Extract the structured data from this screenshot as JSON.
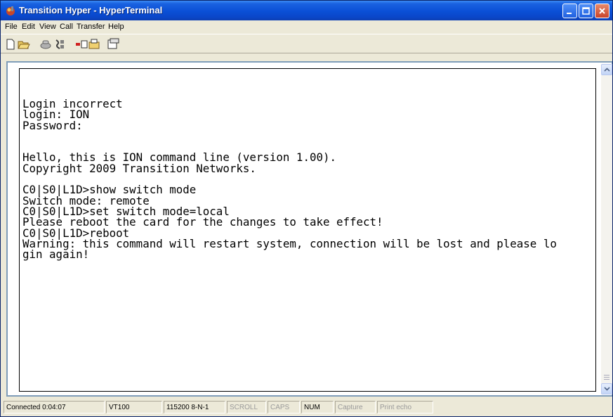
{
  "window": {
    "title": "Transition Hyper - HyperTerminal"
  },
  "menu": [
    "File",
    "Edit",
    "View",
    "Call",
    "Transfer",
    "Help"
  ],
  "toolbar": [
    "new-document-icon",
    "open-folder-icon",
    "call-icon",
    "disconnect-icon",
    "send-icon",
    "receive-icon",
    "properties-icon"
  ],
  "terminal": {
    "lines": [
      "Login incorrect",
      "login: ION",
      "Password:",
      "",
      "",
      "Hello, this is ION command line (version 1.00).",
      "Copyright 2009 Transition Networks.",
      "",
      "C0|S0|L1D>show switch mode",
      "Switch mode: remote",
      "C0|S0|L1D>set switch mode=local",
      "Please reboot the card for the changes to take effect!",
      "C0|S0|L1D>reboot",
      "Warning: this command will restart system, connection will be lost and please lo",
      "gin again!"
    ]
  },
  "status": {
    "connected": "Connected 0:04:07",
    "emulation": "VT100",
    "settings": "115200 8-N-1",
    "scroll": "SCROLL",
    "caps": "CAPS",
    "num": "NUM",
    "capture": "Capture",
    "print_echo": "Print echo"
  }
}
